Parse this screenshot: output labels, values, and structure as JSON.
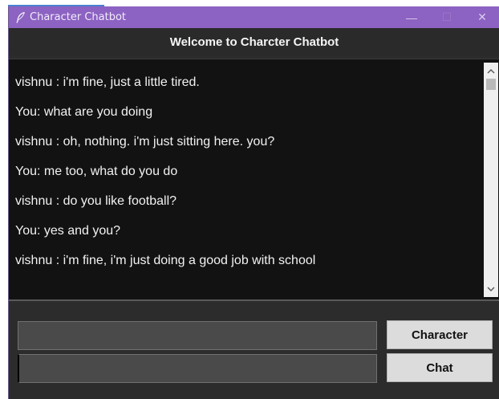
{
  "window": {
    "title": "Character Chatbot",
    "controls": {
      "minimize": "—",
      "maximize": "☐",
      "close": "✕"
    }
  },
  "header": {
    "title": "Welcome to Charcter Chatbot"
  },
  "chat": {
    "messages": [
      "vishnu : i'm fine, just a little tired.",
      "You: what are you doing",
      "vishnu : oh, nothing. i'm just sitting here. you?",
      "You: me too, what do you do",
      "vishnu : do you like football?",
      "You: yes and you?",
      "vishnu : i'm fine, i'm just doing a good job with school"
    ]
  },
  "inputs": {
    "character": {
      "value": "",
      "placeholder": ""
    },
    "message": {
      "value": "",
      "placeholder": ""
    }
  },
  "buttons": {
    "character_label": "Character",
    "chat_label": "Chat"
  },
  "colors": {
    "titlebar": "#8c62c2",
    "header_bg": "#2a2a2a",
    "chat_bg": "#121212",
    "panel_bg": "#2c2c2c",
    "input_bg": "#4a4a4a",
    "button_bg": "#dcdcdc"
  },
  "icons": {
    "app": "feather-icon",
    "scroll_up": "chevron-up-icon",
    "scroll_down": "chevron-down-icon"
  }
}
